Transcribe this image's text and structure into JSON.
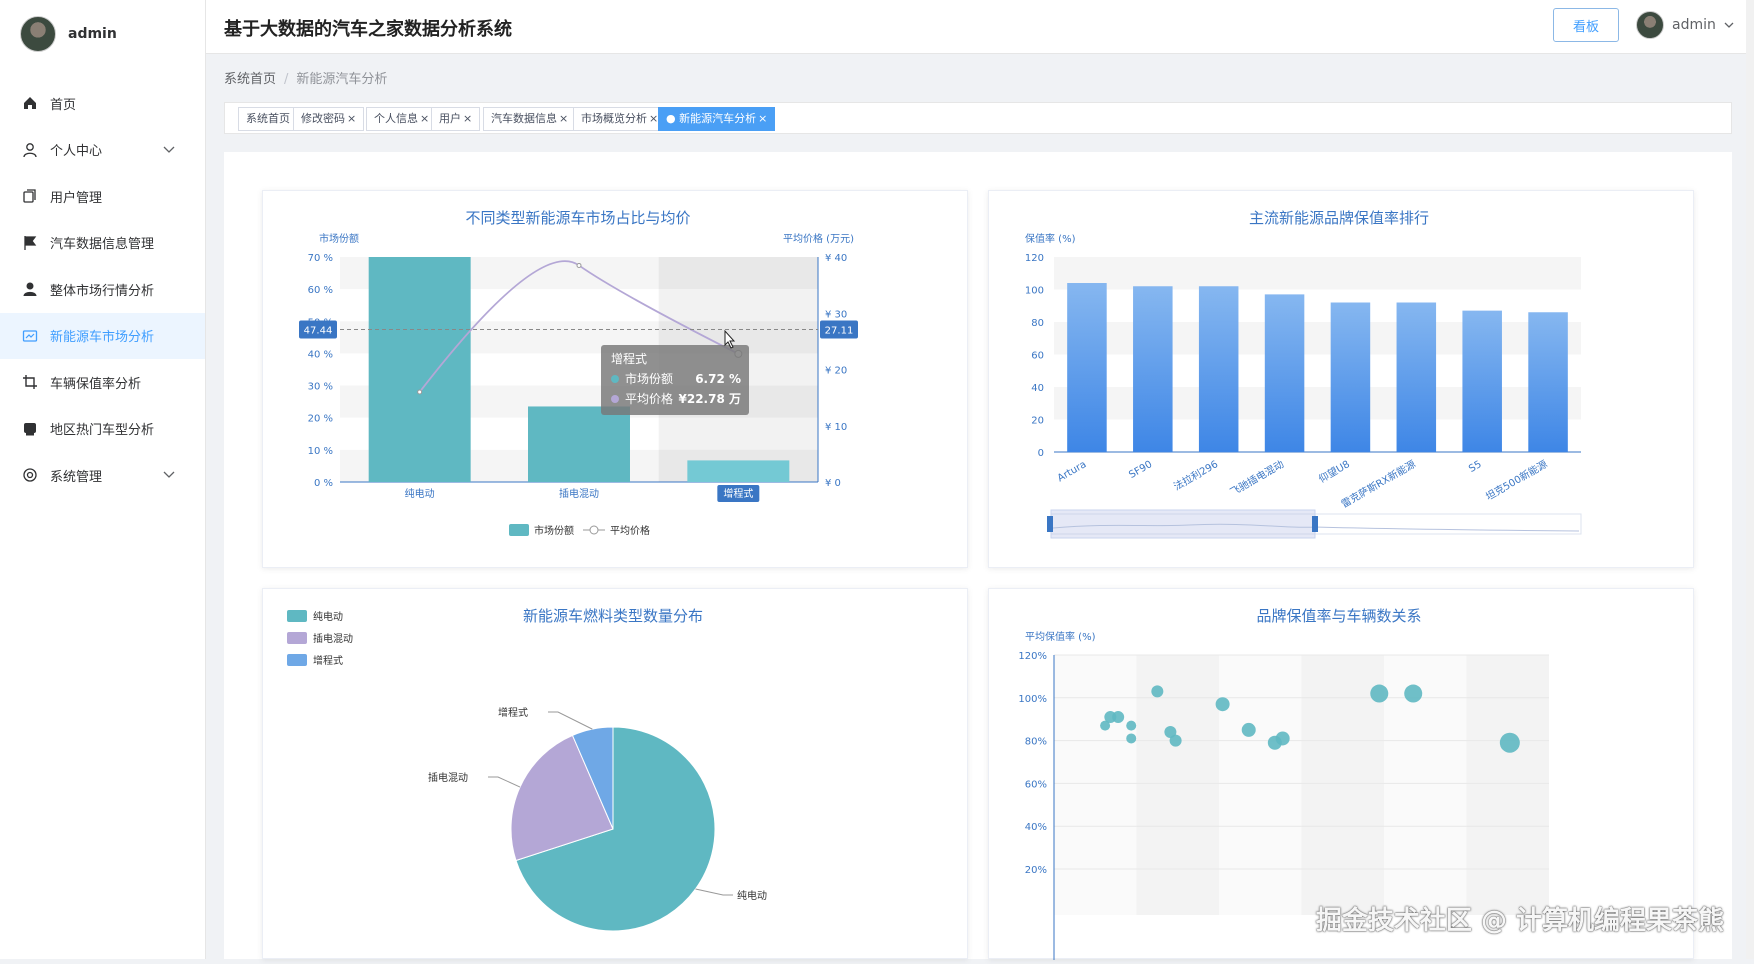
{
  "sidebar": {
    "username": "admin",
    "items": [
      {
        "label": "首页",
        "icon": "home-icon",
        "expandable": false,
        "active": false
      },
      {
        "label": "个人中心",
        "icon": "person-icon",
        "expandable": true,
        "active": false
      },
      {
        "label": "用户管理",
        "icon": "copy-icon",
        "expandable": false,
        "active": false
      },
      {
        "label": "汽车数据信息管理",
        "icon": "flag-icon",
        "expandable": false,
        "active": false
      },
      {
        "label": "整体市场行情分析",
        "icon": "user-solid-icon",
        "expandable": false,
        "active": false
      },
      {
        "label": "新能源车市场分析",
        "icon": "picture-icon",
        "expandable": false,
        "active": true
      },
      {
        "label": "车辆保值率分析",
        "icon": "crop-icon",
        "expandable": false,
        "active": false
      },
      {
        "label": "地区热门车型分析",
        "icon": "tablet-icon",
        "expandable": false,
        "active": false
      },
      {
        "label": "系统管理",
        "icon": "setting-icon",
        "expandable": true,
        "active": false
      }
    ]
  },
  "header": {
    "title": "基于大数据的汽车之家数据分析系统",
    "board_button": "看板",
    "user": "admin"
  },
  "breadcrumb": {
    "home": "系统首页",
    "separator": "/",
    "current": "新能源汽车分析"
  },
  "tags": [
    {
      "label": "系统首页",
      "closable": false,
      "active": false
    },
    {
      "label": "修改密码",
      "closable": true,
      "active": false
    },
    {
      "label": "个人信息",
      "closable": true,
      "active": false
    },
    {
      "label": "用户",
      "closable": true,
      "active": false
    },
    {
      "label": "汽车数据信息",
      "closable": true,
      "active": false
    },
    {
      "label": "市场概览分析",
      "closable": true,
      "active": false
    },
    {
      "label": "新能源汽车分析",
      "closable": true,
      "active": true
    }
  ],
  "colors": {
    "accent": "#409eff",
    "teal": "#5fb8c2",
    "purple": "#b4a7d6",
    "blue": "#6fa8e6",
    "bar_blue": "#4a8fe8"
  },
  "chart_data": [
    {
      "type": "bar",
      "title": "不同类型新能源车市场占比与均价",
      "ylabel": "市场份额",
      "ylabel2": "平均价格 (万元)",
      "categories": [
        "纯电动",
        "插电混动",
        "增程式"
      ],
      "ylim": [
        0,
        70
      ],
      "ylim2": [
        0,
        40
      ],
      "yticks": [
        "70 %",
        "60 %",
        "50 %",
        "40 %",
        "30 %",
        "20 %",
        "10 %",
        "0 %"
      ],
      "yticks2": [
        "¥ 40",
        "¥ 30",
        "¥ 20",
        "¥ 10",
        "¥ 0"
      ],
      "series": [
        {
          "name": "市场份额",
          "kind": "bar",
          "values": [
            70,
            23.5,
            6.72
          ]
        },
        {
          "name": "平均价格",
          "kind": "line",
          "values": [
            16,
            38.5,
            22.78
          ]
        }
      ],
      "legend": [
        "市场份额",
        "平均价格"
      ],
      "crosshair": {
        "left_label": "47.44",
        "right_label": "27.11",
        "value_share": 47.44
      },
      "tooltip": {
        "title": "增程式",
        "rows": [
          {
            "name": "市场份额",
            "value": "6.72 %"
          },
          {
            "name": "平均价格",
            "value": "¥22.78 万"
          }
        ]
      },
      "highlight_category": "增程式"
    },
    {
      "type": "bar",
      "title": "主流新能源品牌保值率排行",
      "ylabel": "保值率 (%)",
      "categories": [
        "Artura",
        "SF90",
        "法拉利296",
        "飞驰插电混动",
        "仰望U8",
        "雷克萨斯RX新能源",
        "S5",
        "坦克500新能源"
      ],
      "values": [
        104,
        102,
        102,
        97,
        92,
        92,
        87,
        86
      ],
      "ylim": [
        0,
        120
      ],
      "yticks": [
        "120",
        "100",
        "80",
        "60",
        "40",
        "20",
        "0"
      ],
      "datazoom": true
    },
    {
      "type": "pie",
      "title": "新能源车燃料类型数量分布",
      "legend": [
        "纯电动",
        "插电混动",
        "增程式"
      ],
      "slices": [
        {
          "name": "纯电动",
          "value": 70
        },
        {
          "name": "插电混动",
          "value": 23.5
        },
        {
          "name": "增程式",
          "value": 6.5
        }
      ]
    },
    {
      "type": "scatter",
      "title": "品牌保值率与车辆数关系",
      "ylabel": "平均保值率 (%)",
      "yticks": [
        "120%",
        "100%",
        "80%",
        "60%",
        "40%",
        "20%"
      ],
      "ylim": [
        20,
        120
      ],
      "points": [
        {
          "x": 1,
          "y": 87,
          "r": 5
        },
        {
          "x": 1.2,
          "y": 91,
          "r": 6
        },
        {
          "x": 1.5,
          "y": 91,
          "r": 6
        },
        {
          "x": 2,
          "y": 87,
          "r": 5
        },
        {
          "x": 2,
          "y": 81,
          "r": 5
        },
        {
          "x": 3,
          "y": 103,
          "r": 6
        },
        {
          "x": 3.5,
          "y": 84,
          "r": 6
        },
        {
          "x": 3.7,
          "y": 80,
          "r": 6
        },
        {
          "x": 5.5,
          "y": 97,
          "r": 7
        },
        {
          "x": 6.5,
          "y": 85,
          "r": 7
        },
        {
          "x": 7.5,
          "y": 79,
          "r": 7
        },
        {
          "x": 7.8,
          "y": 81,
          "r": 7
        },
        {
          "x": 11.5,
          "y": 102,
          "r": 9
        },
        {
          "x": 12.8,
          "y": 102,
          "r": 9
        },
        {
          "x": 16.5,
          "y": 79,
          "r": 10
        }
      ]
    }
  ],
  "watermark": "掘金技术社区 @ 计算机编程果茶熊"
}
